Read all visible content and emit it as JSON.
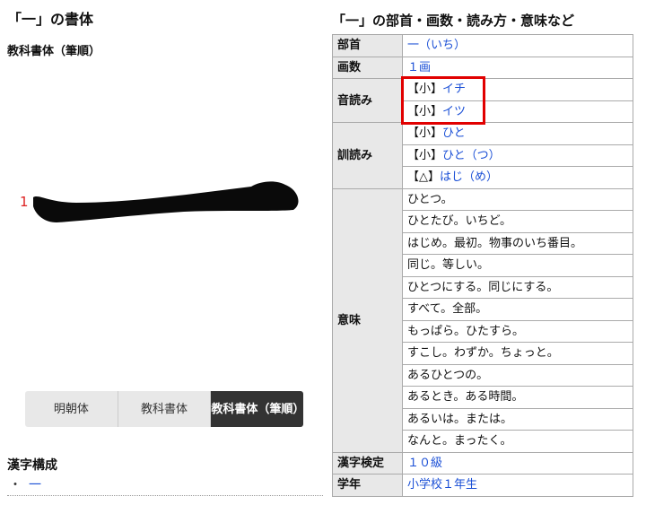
{
  "left": {
    "title": "「一」の書体",
    "subtitle": "教科書体（筆順）",
    "stroke_number": "1",
    "font_tabs": [
      {
        "label": "明朝体"
      },
      {
        "label": "教科書体"
      },
      {
        "label": "教科書体（筆順）"
      }
    ],
    "kosei_heading": "漢字構成",
    "kosei_bullet": "・",
    "kosei_link": "一"
  },
  "right": {
    "title": "「一」の部首・画数・読み方・意味など",
    "rows": {
      "bushu_label": "部首",
      "bushu_value": "一（いち）",
      "kakusu_label": "画数",
      "kakusu_value": "１画",
      "onyomi_label": "音読み",
      "onyomi": [
        {
          "tag": "【小】",
          "value": "イチ"
        },
        {
          "tag": "【小】",
          "value": "イツ"
        }
      ],
      "kunyomi_label": "訓読み",
      "kunyomi": [
        {
          "tag": "【小】",
          "value": "ひと"
        },
        {
          "tag": "【小】",
          "value": "ひと（つ）"
        },
        {
          "tag": "【△】",
          "value": "はじ（め）"
        }
      ],
      "imi_label": "意味",
      "imi": [
        "ひとつ。",
        "ひとたび。いちど。",
        "はじめ。最初。物事のいち番目。",
        "同じ。等しい。",
        "ひとつにする。同じにする。",
        "すべて。全部。",
        "もっぱら。ひたすら。",
        "すこし。わずか。ちょっと。",
        "あるひとつの。",
        "あるとき。ある時間。",
        "あるいは。または。",
        "なんと。まったく。"
      ],
      "kentei_label": "漢字検定",
      "kentei_value": "１０級",
      "gakunen_label": "学年",
      "gakunen_value": "小学校１年生"
    }
  },
  "colors": {
    "link": "#1a4fd6",
    "highlight": "#e10000",
    "stroke_number": "#d22222"
  }
}
